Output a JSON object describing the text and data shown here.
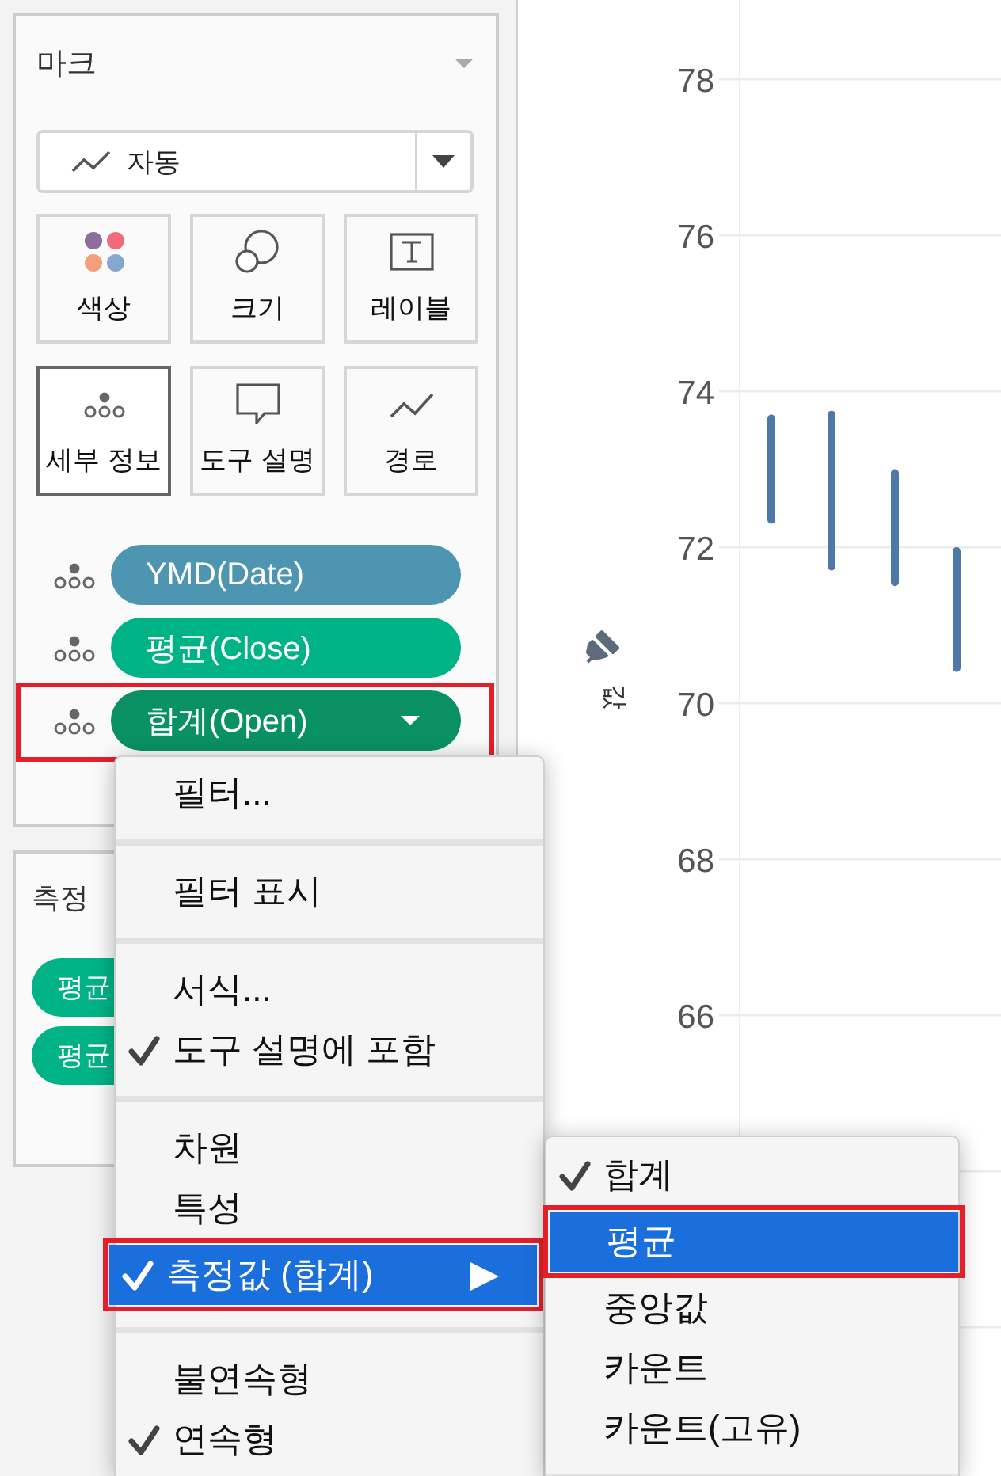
{
  "marks_card": {
    "title": "마크",
    "mark_type": {
      "label": "자동"
    },
    "tiles": [
      {
        "label": "색상",
        "kind": "color",
        "selected": false
      },
      {
        "label": "크기",
        "kind": "size",
        "selected": false
      },
      {
        "label": "레이블",
        "kind": "label",
        "selected": false
      },
      {
        "label": "세부 정보",
        "kind": "detail",
        "selected": true
      },
      {
        "label": "도구 설명",
        "kind": "tooltip",
        "selected": false
      },
      {
        "label": "경로",
        "kind": "path",
        "selected": false
      }
    ],
    "fields": [
      {
        "label": "YMD(Date)",
        "color": "#4e95b2",
        "open": false,
        "outlined": false
      },
      {
        "label": "평균(Close)",
        "color": "#00b386",
        "open": false,
        "outlined": false
      },
      {
        "label": "합계(Open)",
        "color": "#0a9163",
        "open": true,
        "outlined": true
      }
    ]
  },
  "measures_card": {
    "title": "측정",
    "fields": [
      {
        "label": "평균",
        "color": "#00b386"
      },
      {
        "label": "평균",
        "color": "#00b386"
      }
    ]
  },
  "chart": {
    "axis_title": "값",
    "y_ticks": [
      "78",
      "76",
      "74",
      "72",
      "70",
      "68",
      "66"
    ]
  },
  "context_menu": {
    "items": [
      {
        "kind": "item",
        "label": "필터...",
        "checked": false,
        "selected": false,
        "submenu": false,
        "outlined": false
      },
      {
        "kind": "separator"
      },
      {
        "kind": "item",
        "label": "필터 표시",
        "checked": false,
        "selected": false,
        "submenu": false,
        "outlined": false
      },
      {
        "kind": "separator"
      },
      {
        "kind": "item",
        "label": "서식...",
        "checked": false,
        "selected": false,
        "submenu": false,
        "outlined": false
      },
      {
        "kind": "item",
        "label": "도구 설명에 포함",
        "checked": true,
        "selected": false,
        "submenu": false,
        "outlined": false
      },
      {
        "kind": "separator"
      },
      {
        "kind": "item",
        "label": "차원",
        "checked": false,
        "selected": false,
        "submenu": false,
        "outlined": false
      },
      {
        "kind": "item",
        "label": "특성",
        "checked": false,
        "selected": false,
        "submenu": false,
        "outlined": false
      },
      {
        "kind": "item",
        "label": "측정값 (합계)",
        "checked": true,
        "selected": true,
        "submenu": true,
        "outlined": true
      },
      {
        "kind": "separator"
      },
      {
        "kind": "item",
        "label": "불연속형",
        "checked": false,
        "selected": false,
        "submenu": false,
        "outlined": false
      },
      {
        "kind": "item",
        "label": "연속형",
        "checked": true,
        "selected": false,
        "submenu": false,
        "outlined": false
      }
    ]
  },
  "submenu": {
    "items": [
      {
        "kind": "item",
        "label": "합계",
        "checked": true,
        "selected": false,
        "submenu": false,
        "outlined": false
      },
      {
        "kind": "item",
        "label": "평균",
        "checked": false,
        "selected": true,
        "submenu": false,
        "outlined": true
      },
      {
        "kind": "item",
        "label": "중앙값",
        "checked": false,
        "selected": false,
        "submenu": false,
        "outlined": false
      },
      {
        "kind": "item",
        "label": "카운트",
        "checked": false,
        "selected": false,
        "submenu": false,
        "outlined": false
      },
      {
        "kind": "item",
        "label": "카운트(고유)",
        "checked": false,
        "selected": false,
        "submenu": false,
        "outlined": false
      },
      {
        "kind": "separator"
      }
    ]
  }
}
